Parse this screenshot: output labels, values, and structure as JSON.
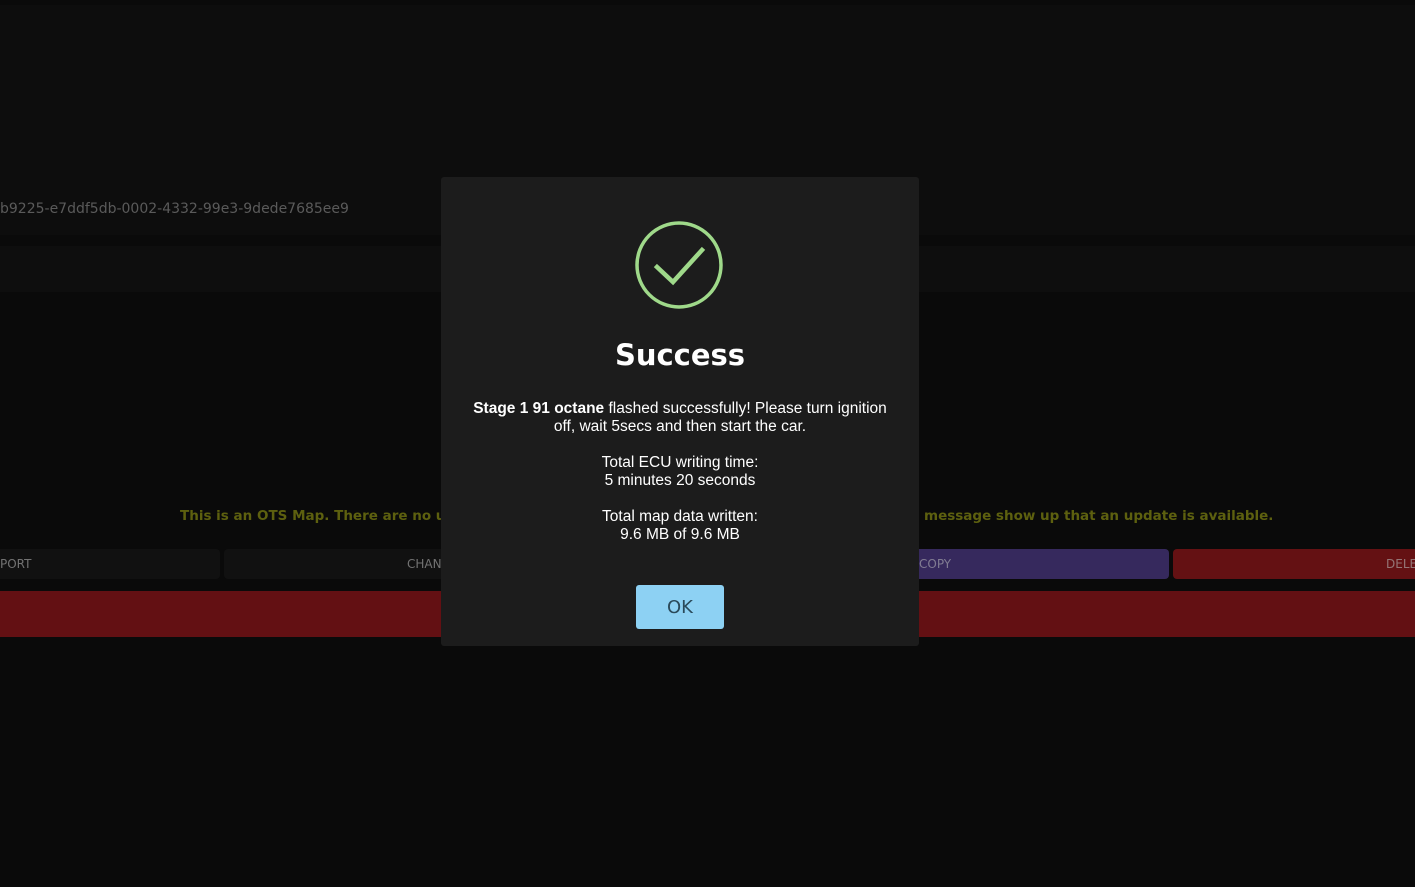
{
  "background": {
    "device_id": "b9225-e7ddf5db-0002-4332-99e3-9dede7685ee9",
    "ots_message_left": "This is an OTS Map. There are no update",
    "ots_message_right": "message show up that an update is available.",
    "buttons": {
      "export": "PORT",
      "change": "CHAN",
      "copy": "COPY",
      "delete": "DELE"
    }
  },
  "modal": {
    "icon": "check-circle-icon",
    "title": "Success",
    "map_name": "Stage 1 91 octane",
    "flash_message": " flashed successfully! Please turn ignition off, wait 5secs and then start the car.",
    "write_time_label": "Total ECU writing time:",
    "write_time_value": "5 minutes 20 seconds",
    "data_written_label": "Total map data written:",
    "data_written_value": "9.6 MB of 9.6 MB",
    "ok_label": "OK"
  },
  "colors": {
    "success_green": "#9fd98a",
    "ok_button": "#8dd1f3",
    "copy_button": "#54408f",
    "delete_button": "#991a1e",
    "ots_text": "#8f9417"
  }
}
